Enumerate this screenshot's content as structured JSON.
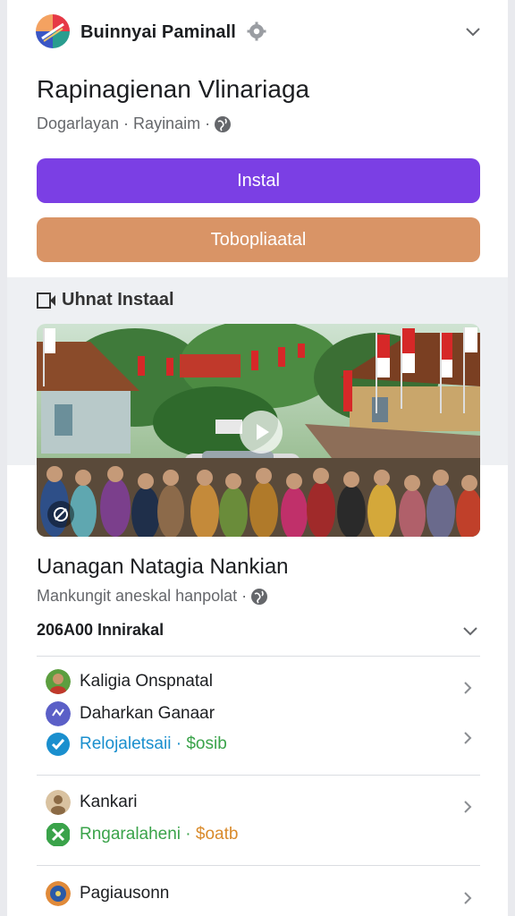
{
  "header": {
    "app_name": "Buinnyai Paminall",
    "title": "Rapinagienan Vlinariaga",
    "subtitle": "Dogarlayan · Rayinaim ·"
  },
  "buttons": {
    "install": "Instal",
    "secondary": "Tobopliaatal"
  },
  "section": {
    "label": "Uhnat Instaal"
  },
  "post": {
    "title": "Uanagan Natagia Nankian",
    "meta": "Mankungit aneskal hanpolat ·",
    "count": "206A00 Innirakal"
  },
  "list": [
    {
      "lines": [
        {
          "text": "Kaligia Onspnatal",
          "icon": "avatar-photo"
        },
        {
          "text": "Daharkan Ganaar",
          "icon": "avatar-blue"
        },
        {
          "text": "Relojaletsaii",
          "sep": " · ",
          "price": "$osib",
          "icon": "check-icon"
        }
      ]
    },
    {
      "lines": [
        {
          "text": "Kankari",
          "icon": "avatar-beige"
        },
        {
          "text": "Rngaralaheni",
          "sep": " · ",
          "price": "$oatb",
          "icon": "x-icon"
        }
      ]
    },
    {
      "lines": [
        {
          "text": "Pagiausonn",
          "icon": "avatar-blue-orange"
        }
      ]
    }
  ],
  "colors": {
    "install_bg": "#7b3fe4",
    "secondary_bg": "#d99466",
    "link_blue": "#1a8fce",
    "green": "#3aa34a"
  }
}
